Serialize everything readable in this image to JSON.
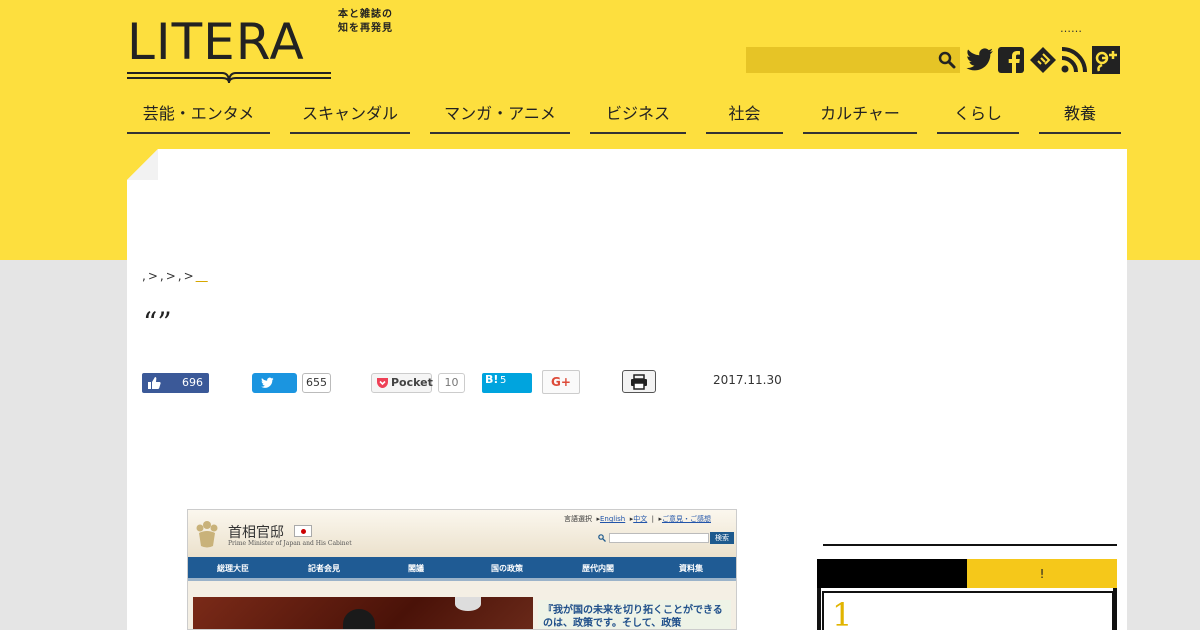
{
  "header": {
    "logo_text": "LITERA",
    "tagline_line1": "本と雑誌の",
    "tagline_line2": "知を再発見",
    "dots": "……",
    "search_placeholder": ""
  },
  "social_icons": [
    "twitter-icon",
    "facebook-icon",
    "feedly-icon",
    "rss-icon",
    "google-plus-icon"
  ],
  "nav": {
    "items": [
      {
        "label": "芸能・エンタメ"
      },
      {
        "label": "スキャンダル"
      },
      {
        "label": "マンガ・アニメ"
      },
      {
        "label": "ビジネス"
      },
      {
        "label": "社会"
      },
      {
        "label": "カルチャー"
      },
      {
        "label": "くらし"
      },
      {
        "label": "教養"
      }
    ]
  },
  "breadcrumb": {
    "items": [
      ",",
      ">",
      ",",
      ">",
      ",",
      ">"
    ],
    "current": "＿"
  },
  "article": {
    "title": "“”",
    "date": "2017.11.30"
  },
  "share": {
    "facebook_count": "696",
    "twitter_count": "655",
    "pocket_label": "Pocket",
    "pocket_count": "10",
    "hatena_label": "B!",
    "hatena_count": "5",
    "gplus_label": "G+"
  },
  "embedded_screenshot": {
    "site_title": "首相官邸",
    "site_subtitle": "Prime Minister of Japan and His Cabinet",
    "lang_label": "言語選択",
    "lang_english": "English",
    "lang_chinese": "中文",
    "feedback": "ご意見・ご感想",
    "search_button": "検索",
    "nav": [
      "総理大臣",
      "記者会見",
      "閣議",
      "国の政策",
      "歴代内閣",
      "資料集"
    ],
    "quote": "『我が国の未来を切り拓くことができるのは、政策です。そして、政策"
  },
  "sidebar": {
    "tab_left": "",
    "tab_right": "!",
    "rank_first": "1"
  },
  "colors": {
    "header_yellow": "#fddf3e",
    "accent_gold": "#f5c81a",
    "facebook": "#3b5998",
    "twitter": "#1b95e0",
    "hatena": "#00a4de"
  }
}
